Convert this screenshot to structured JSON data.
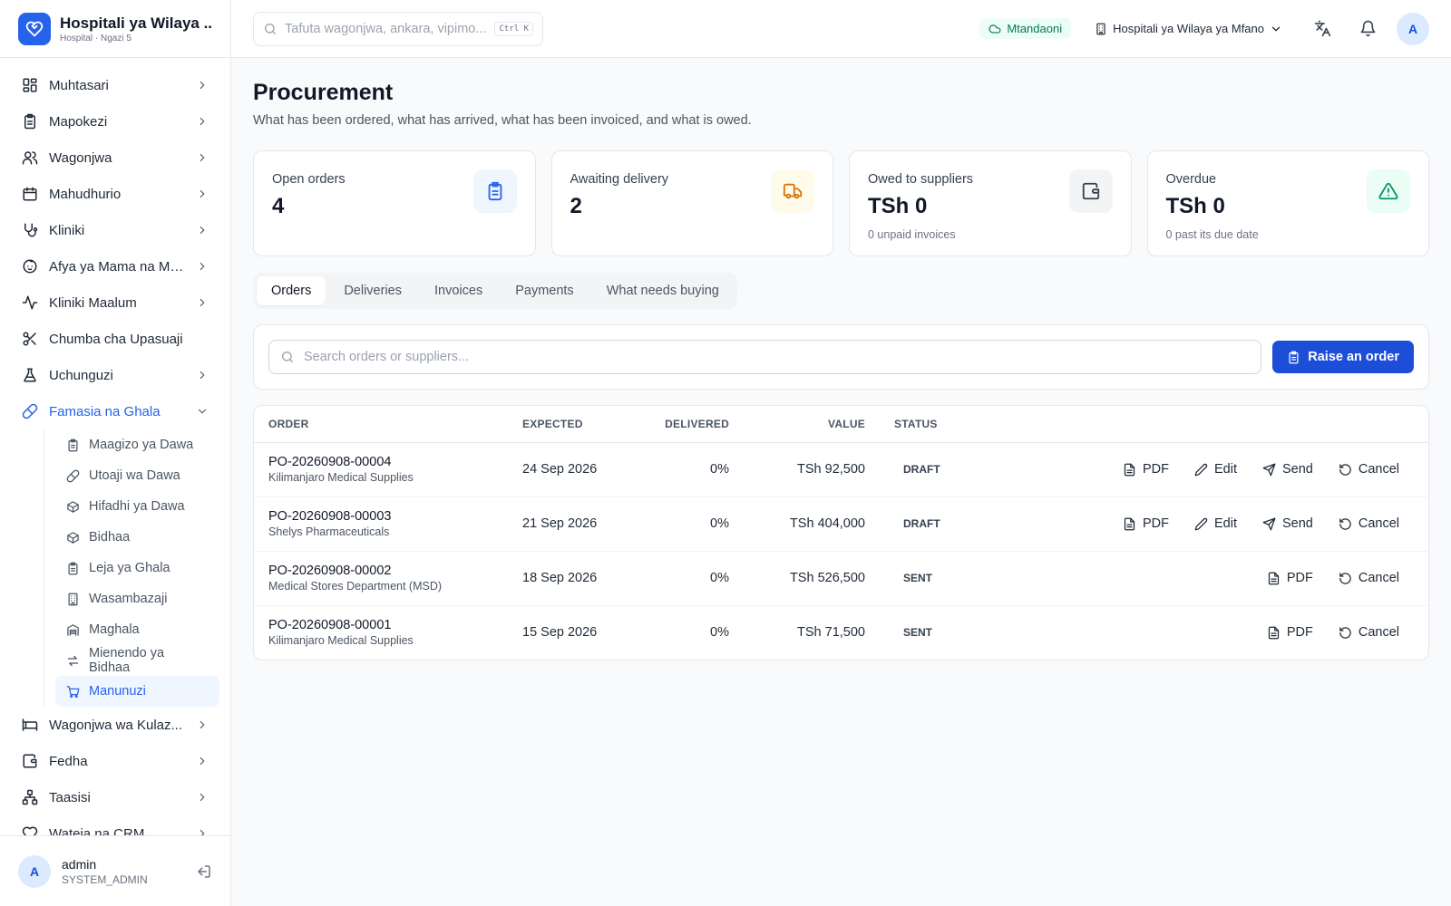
{
  "brand": {
    "title": "Hospitali ya Wilaya ...",
    "subtitle": "Hospital · Ngazi 5",
    "icon": "heart-logo-icon"
  },
  "sidebar": {
    "items": [
      {
        "label": "Muhtasari",
        "icon": "dashboard-icon",
        "chevron": true
      },
      {
        "label": "Mapokezi",
        "icon": "clipboard-icon",
        "chevron": true
      },
      {
        "label": "Wagonjwa",
        "icon": "users-icon",
        "chevron": true
      },
      {
        "label": "Mahudhurio",
        "icon": "calendar-icon",
        "chevron": true
      },
      {
        "label": "Kliniki",
        "icon": "stethoscope-icon",
        "chevron": true
      },
      {
        "label": "Afya ya Mama na Mt...",
        "icon": "baby-icon",
        "chevron": true
      },
      {
        "label": "Kliniki Maalum",
        "icon": "activity-icon",
        "chevron": true
      },
      {
        "label": "Chumba cha Upasuaji",
        "icon": "scissors-icon",
        "chevron": false
      },
      {
        "label": "Uchunguzi",
        "icon": "flask-icon",
        "chevron": true
      },
      {
        "label": "Famasia na Ghala",
        "icon": "pill-icon",
        "chevron": true,
        "expanded": true
      }
    ],
    "subitems": [
      {
        "label": "Maagizo ya Dawa",
        "icon": "clipboard-icon"
      },
      {
        "label": "Utoaji wa Dawa",
        "icon": "pill-icon"
      },
      {
        "label": "Hifadhi ya Dawa",
        "icon": "package-icon"
      },
      {
        "label": "Bidhaa",
        "icon": "package-icon"
      },
      {
        "label": "Leja ya Ghala",
        "icon": "clipboard-icon"
      },
      {
        "label": "Wasambazaji",
        "icon": "building-icon"
      },
      {
        "label": "Maghala",
        "icon": "warehouse-icon"
      },
      {
        "label": "Mienendo ya Bidhaa",
        "icon": "arrows-icon"
      },
      {
        "label": "Manunuzi",
        "icon": "cart-icon",
        "active": true
      }
    ],
    "items_after": [
      {
        "label": "Wagonjwa wa Kulaz...",
        "icon": "bed-icon"
      },
      {
        "label": "Fedha",
        "icon": "wallet-icon"
      },
      {
        "label": "Taasisi",
        "icon": "network-icon"
      },
      {
        "label": "Wateja na CRM",
        "icon": "heart-handshake-icon"
      }
    ]
  },
  "user": {
    "initial": "A",
    "name": "admin",
    "role": "SYSTEM_ADMIN"
  },
  "topbar": {
    "search_placeholder": "Tafuta wagonjwa, ankara, vipimo...",
    "shortcut": "Ctrl K",
    "status": "Mtandaoni",
    "facility": "Hospitali ya Wilaya ya Mfano",
    "avatar": "A"
  },
  "page": {
    "title": "Procurement",
    "subtitle": "What has been ordered, what has arrived, what has been invoiced, and what is owed."
  },
  "stats": [
    {
      "label": "Open orders",
      "value": "4",
      "note": "",
      "icon": "clipboard-icon",
      "bg": "#eff6ff",
      "color": "#2563eb"
    },
    {
      "label": "Awaiting delivery",
      "value": "2",
      "note": "",
      "icon": "truck-icon",
      "bg": "#fffbeb",
      "color": "#d97706"
    },
    {
      "label": "Owed to suppliers",
      "value": "TSh 0",
      "note": "0 unpaid invoices",
      "icon": "wallet-icon",
      "bg": "#f3f4f6",
      "color": "#374151"
    },
    {
      "label": "Overdue",
      "value": "TSh 0",
      "note": "0 past its due date",
      "icon": "alert-triangle-icon",
      "bg": "#ecfdf5",
      "color": "#059669"
    }
  ],
  "tabs": [
    "Orders",
    "Deliveries",
    "Invoices",
    "Payments",
    "What needs buying"
  ],
  "active_tab": "Orders",
  "filter": {
    "placeholder": "Search orders or suppliers...",
    "button": "Raise an order"
  },
  "table": {
    "headers": {
      "order": "ORDER",
      "expected": "EXPECTED",
      "delivered": "DELIVERED",
      "value": "VALUE",
      "status": "STATUS"
    },
    "rows": [
      {
        "order": "PO-20260908-00004",
        "supplier": "Kilimanjaro Medical Supplies",
        "expected": "24 Sep 2026",
        "delivered": "0%",
        "value": "TSh 92,500",
        "status": "DRAFT",
        "actions": [
          "PDF",
          "Edit",
          "Send",
          "Cancel"
        ]
      },
      {
        "order": "PO-20260908-00003",
        "supplier": "Shelys Pharmaceuticals",
        "expected": "21 Sep 2026",
        "delivered": "0%",
        "value": "TSh 404,000",
        "status": "DRAFT",
        "actions": [
          "PDF",
          "Edit",
          "Send",
          "Cancel"
        ]
      },
      {
        "order": "PO-20260908-00002",
        "supplier": "Medical Stores Department (MSD)",
        "expected": "18 Sep 2026",
        "delivered": "0%",
        "value": "TSh 526,500",
        "status": "SENT",
        "actions": [
          "PDF",
          "Cancel"
        ]
      },
      {
        "order": "PO-20260908-00001",
        "supplier": "Kilimanjaro Medical Supplies",
        "expected": "15 Sep 2026",
        "delivered": "0%",
        "value": "TSh 71,500",
        "status": "SENT",
        "actions": [
          "PDF",
          "Cancel"
        ]
      }
    ]
  }
}
